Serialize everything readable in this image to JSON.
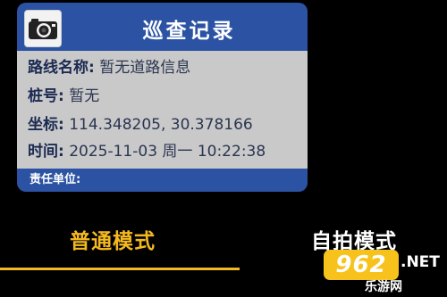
{
  "card": {
    "title": "巡查记录",
    "icon": "camera-icon",
    "road_name_label": "路线名称:",
    "road_name_value": "暂无道路信息",
    "stake_label": "桩号:",
    "stake_value": "暂无",
    "coord_label": "坐标:",
    "coord_value": "114.348205, 30.378166",
    "time_label": "时间:",
    "time_value": "2025-11-03 周一 10:22:38",
    "unit_label": "责任单位:"
  },
  "modes": {
    "normal": "普通模式",
    "selfie": "自拍模式",
    "active_color": "#f5b920"
  },
  "watermark": {
    "badge": "962",
    "suffix": ".NET",
    "site": "乐游网"
  },
  "colors": {
    "card_blue": "#2c53a3",
    "info_gray": "#c9c9c9",
    "background": "#000000"
  }
}
